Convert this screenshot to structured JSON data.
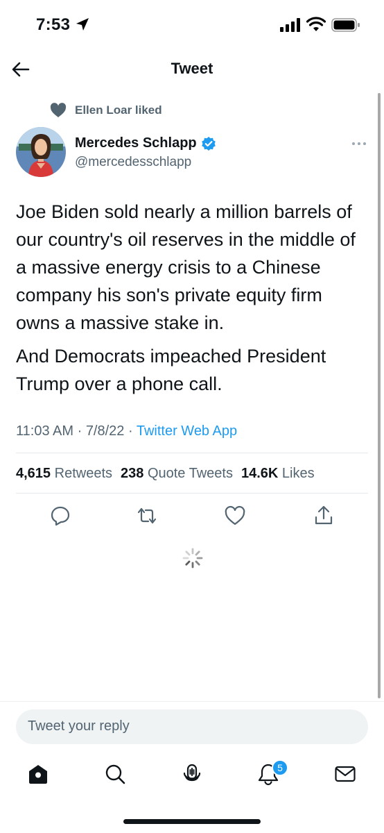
{
  "status_bar": {
    "time": "7:53"
  },
  "header": {
    "title": "Tweet"
  },
  "social_context": {
    "text": "Ellen Loar liked"
  },
  "author": {
    "name": "Mercedes Schlapp",
    "handle": "@mercedesschlapp"
  },
  "tweet": {
    "paragraphs": [
      "Joe Biden sold nearly a million barrels of our country's oil reserves in the middle of a massive energy crisis to a Chinese company his son's private equity firm owns a massive stake in.",
      "And Democrats impeached President Trump over a phone call."
    ],
    "time": "11:03 AM",
    "date": "7/8/22",
    "source": "Twitter Web App"
  },
  "stats": {
    "retweets_count": "4,615",
    "retweets_label": "Retweets",
    "quotes_count": "238",
    "quotes_label": "Quote Tweets",
    "likes_count": "14.6K",
    "likes_label": "Likes"
  },
  "actions": [
    "reply-icon",
    "retweet-icon",
    "like-icon",
    "share-icon"
  ],
  "reply": {
    "placeholder": "Tweet your reply"
  },
  "tab_bar": {
    "items": [
      "home-icon",
      "search-icon",
      "spaces-icon",
      "notifications-icon",
      "messages-icon"
    ],
    "notifications_badge": "5"
  },
  "colors": {
    "accent": "#1d9bf0",
    "text": "#0f1419",
    "secondary": "#536471",
    "verified": "#1d9bf0"
  }
}
